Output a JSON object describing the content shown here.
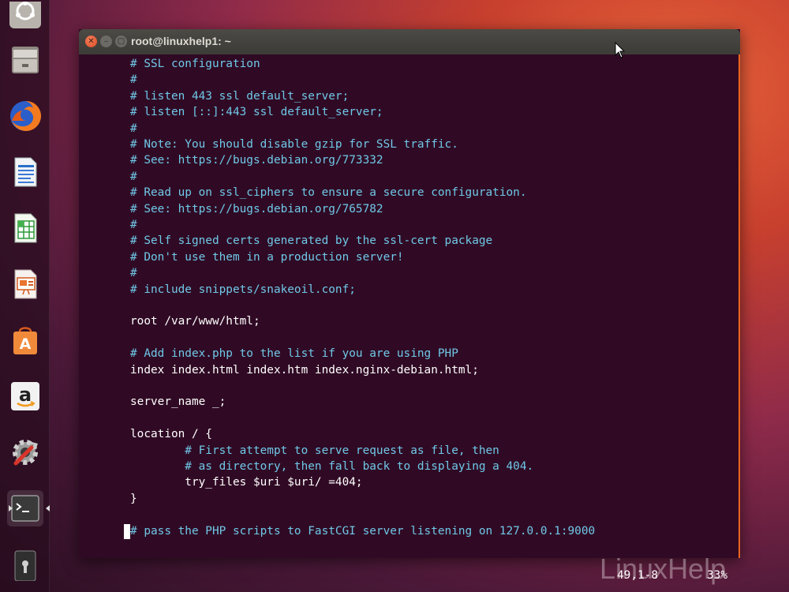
{
  "window": {
    "title": "root@linuxhelp1: ~"
  },
  "window_buttons": {
    "close": "✕",
    "minimize": "–",
    "maximize": "▢"
  },
  "launcher": {
    "items": [
      {
        "name": "ubuntu-dash-icon"
      },
      {
        "name": "files-icon"
      },
      {
        "name": "firefox-icon"
      },
      {
        "name": "libreoffice-writer-icon"
      },
      {
        "name": "libreoffice-calc-icon"
      },
      {
        "name": "libreoffice-impress-icon"
      },
      {
        "name": "ubuntu-software-icon"
      },
      {
        "name": "amazon-icon"
      },
      {
        "name": "system-settings-icon"
      },
      {
        "name": "terminal-icon"
      },
      {
        "name": "usb-drive-icon"
      }
    ]
  },
  "editor": {
    "lines": [
      {
        "text": "# SSL configuration",
        "comment": true
      },
      {
        "text": "#",
        "comment": true
      },
      {
        "text": "# listen 443 ssl default_server;",
        "comment": true
      },
      {
        "text": "# listen [::]:443 ssl default_server;",
        "comment": true
      },
      {
        "text": "#",
        "comment": true
      },
      {
        "text": "# Note: You should disable gzip for SSL traffic.",
        "comment": true
      },
      {
        "text": "# See: https://bugs.debian.org/773332",
        "comment": true
      },
      {
        "text": "#",
        "comment": true
      },
      {
        "text": "# Read up on ssl_ciphers to ensure a secure configuration.",
        "comment": true
      },
      {
        "text": "# See: https://bugs.debian.org/765782",
        "comment": true
      },
      {
        "text": "#",
        "comment": true
      },
      {
        "text": "# Self signed certs generated by the ssl-cert package",
        "comment": true
      },
      {
        "text": "# Don't use them in a production server!",
        "comment": true
      },
      {
        "text": "#",
        "comment": true
      },
      {
        "text": "# include snippets/snakeoil.conf;",
        "comment": true
      },
      {
        "text": "",
        "comment": false
      },
      {
        "text": "root /var/www/html;",
        "comment": false
      },
      {
        "text": "",
        "comment": false
      },
      {
        "text": "# Add index.php to the list if you are using PHP",
        "comment": true
      },
      {
        "text": "index index.html index.htm index.nginx-debian.html;",
        "comment": false
      },
      {
        "text": "",
        "comment": false
      },
      {
        "text": "server_name _;",
        "comment": false
      },
      {
        "text": "",
        "comment": false
      },
      {
        "text": "location / {",
        "comment": false
      },
      {
        "text": "        # First attempt to serve request as file, then",
        "comment": true
      },
      {
        "text": "        # as directory, then fall back to displaying a 404.",
        "comment": true
      },
      {
        "text": "        try_files $uri $uri/ =404;",
        "comment": false
      },
      {
        "text": "}",
        "comment": false
      },
      {
        "text": "",
        "comment": false
      },
      {
        "text": "# pass the PHP scripts to FastCGI server listening on 127.0.0.1:9000",
        "comment": true
      }
    ],
    "status_position": "49,1-8",
    "status_percent": "33%"
  },
  "watermark": "LinuxHelp",
  "colors": {
    "terminal_bg": "#300a24",
    "comment": "#6fc8e8",
    "text": "#ffffff",
    "accent": "#e9641f"
  }
}
